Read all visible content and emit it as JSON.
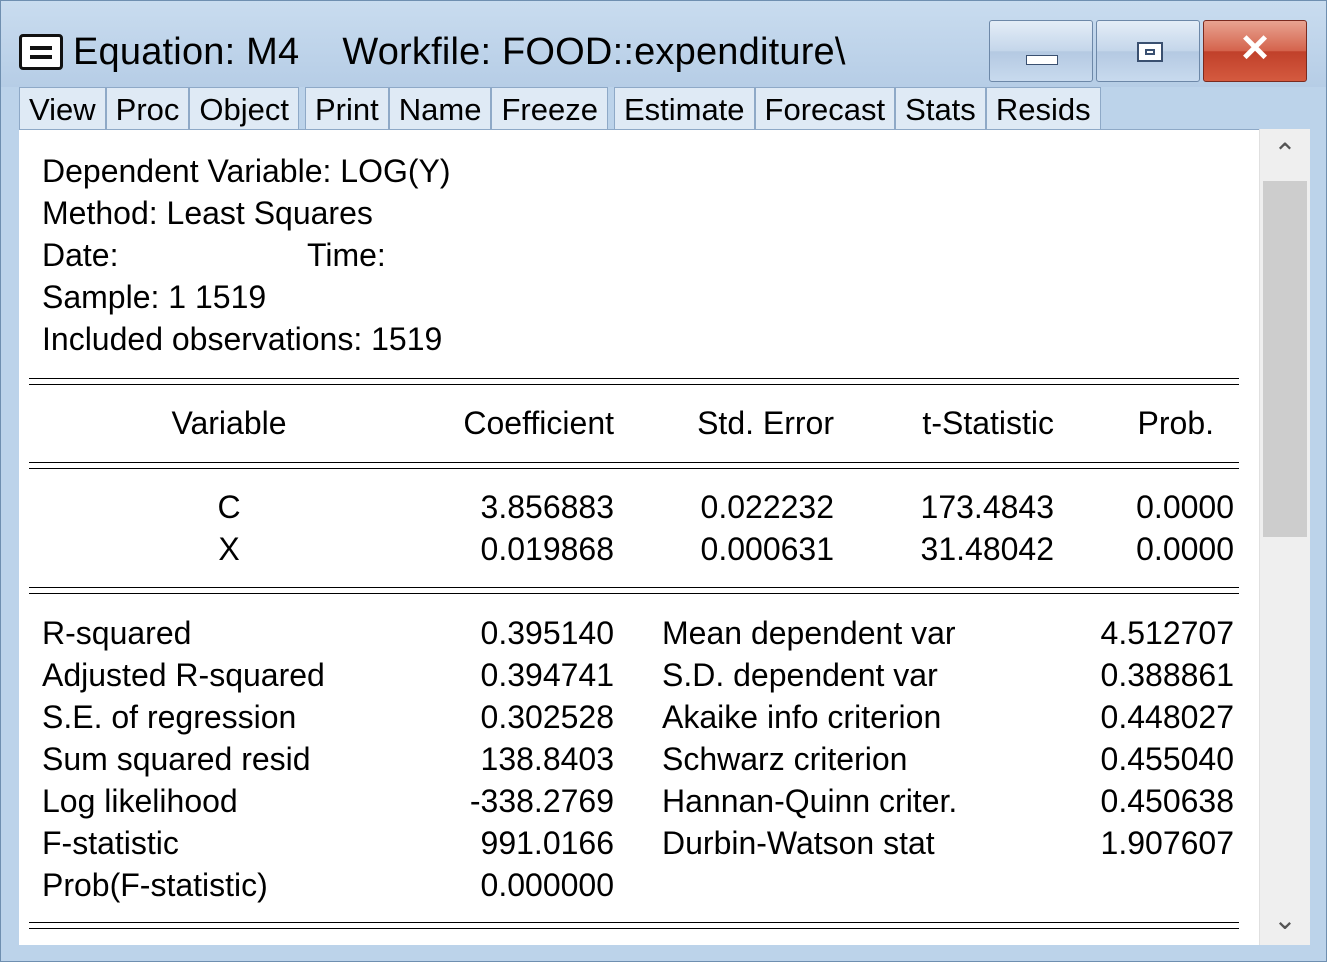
{
  "window": {
    "title": "Equation: M4    Workfile: FOOD::expenditure\\",
    "close_label": "✕"
  },
  "toolbar": [
    "View",
    "Proc",
    "Object",
    "Print",
    "Name",
    "Freeze",
    "Estimate",
    "Forecast",
    "Stats",
    "Resids"
  ],
  "header": {
    "dependent": "Dependent Variable: LOG(Y)",
    "method": "Method: Least Squares",
    "date_label": "Date:",
    "time_label": "Time:",
    "sample": "Sample: 1 1519",
    "included": "Included observations: 1519"
  },
  "table": {
    "columns": [
      "Variable",
      "Coefficient",
      "Std. Error",
      "t-Statistic",
      "Prob."
    ],
    "rows": [
      [
        "C",
        "3.856883",
        "0.022232",
        "173.4843",
        "0.0000"
      ],
      [
        "X",
        "0.019868",
        "0.000631",
        "31.48042",
        "0.0000"
      ]
    ]
  },
  "stats": {
    "left": [
      [
        "R-squared",
        "0.395140"
      ],
      [
        "Adjusted R-squared",
        "0.394741"
      ],
      [
        "S.E. of regression",
        "0.302528"
      ],
      [
        "Sum squared resid",
        "138.8403"
      ],
      [
        "Log likelihood",
        "-338.2769"
      ],
      [
        "F-statistic",
        "991.0166"
      ],
      [
        "Prob(F-statistic)",
        "0.000000"
      ]
    ],
    "right": [
      [
        "Mean dependent var",
        "4.512707"
      ],
      [
        "S.D. dependent var",
        "0.388861"
      ],
      [
        "Akaike info criterion",
        "0.448027"
      ],
      [
        "Schwarz criterion",
        "0.455040"
      ],
      [
        "Hannan-Quinn criter.",
        "0.450638"
      ],
      [
        "Durbin-Watson stat",
        "1.907607"
      ]
    ]
  },
  "scrollbar": {
    "up": "⌃",
    "down": "⌄"
  }
}
